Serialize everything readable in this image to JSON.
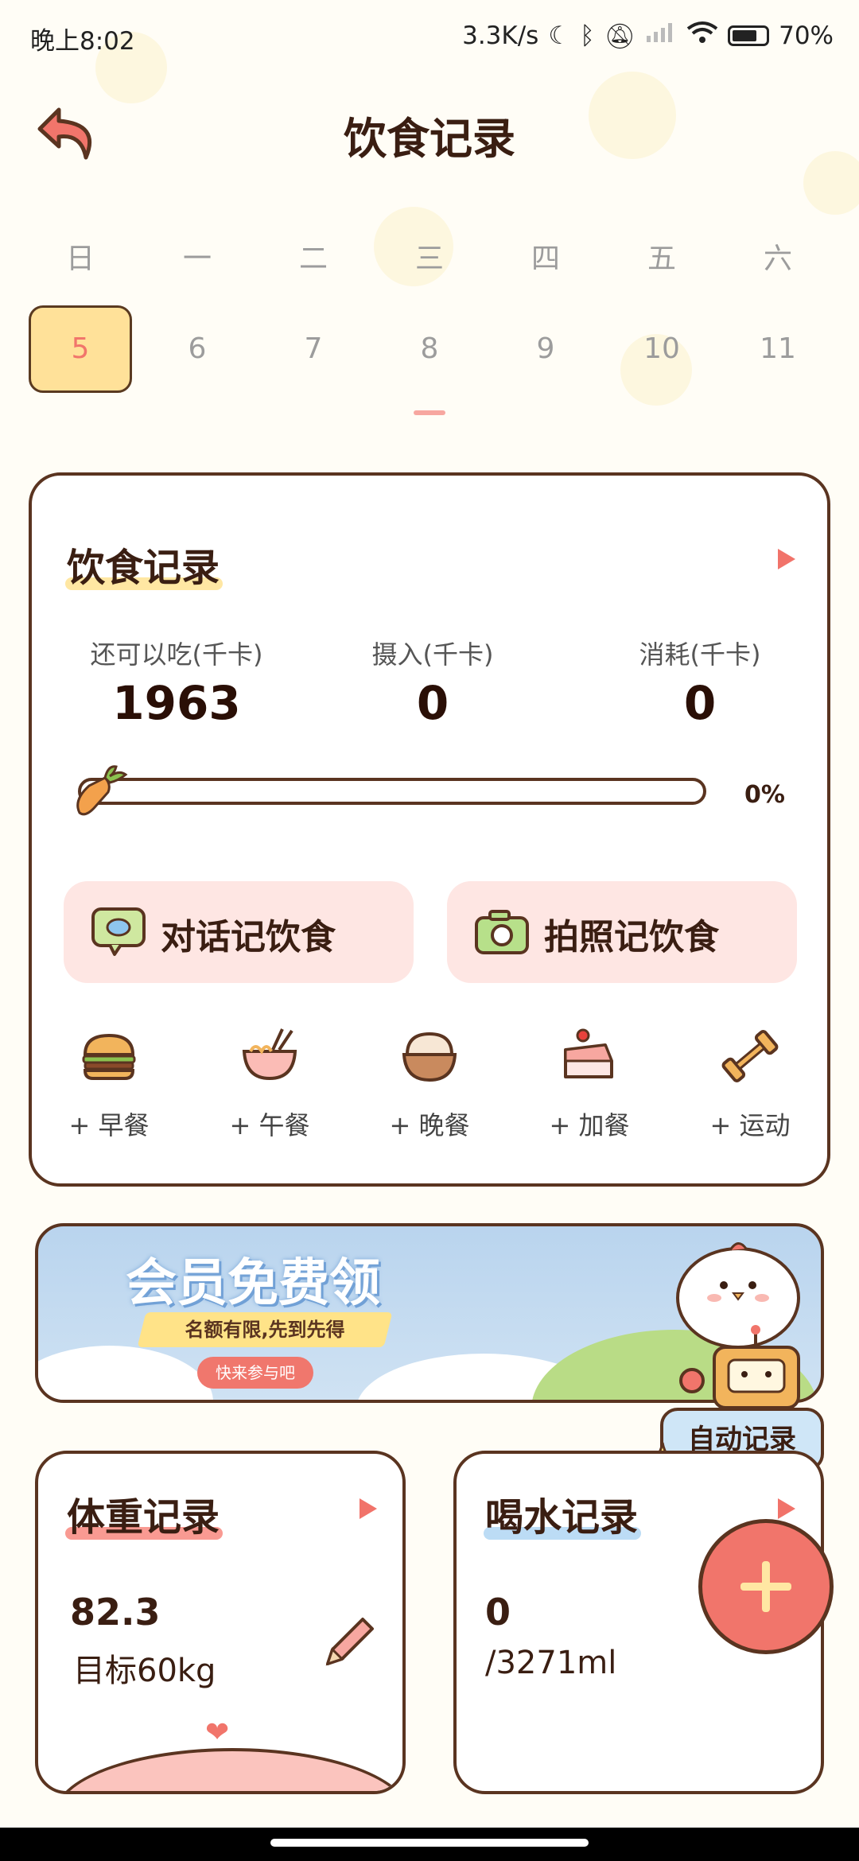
{
  "status_bar": {
    "time": "晚上8:02",
    "speed": "3.3K/s",
    "battery": "70%"
  },
  "header": {
    "title": "饮食记录"
  },
  "week": {
    "days": [
      "日",
      "一",
      "二",
      "三",
      "四",
      "五",
      "六"
    ],
    "dates": [
      "5",
      "6",
      "7",
      "8",
      "9",
      "10",
      "11"
    ],
    "selected_index": 0
  },
  "diet": {
    "title": "饮食记录",
    "remaining_label": "还可以吃(千卡)",
    "remaining_value": "1963",
    "intake_label": "摄入(千卡)",
    "intake_value": "0",
    "burned_label": "消耗(千卡)",
    "burned_value": "0",
    "progress_text": "0%",
    "progress_fraction": 0,
    "chat_button": "对话记饮食",
    "photo_button": "拍照记饮食",
    "meals": [
      "+ 早餐",
      "+ 午餐",
      "+ 晚餐",
      "+ 加餐",
      "+ 运动"
    ]
  },
  "banner": {
    "title": "会员免费领",
    "subtitle": "名额有限,先到先得",
    "button": "快来参与吧"
  },
  "auto_record": "自动记录",
  "weight": {
    "title": "体重记录",
    "value": "82.3",
    "target": "目标60kg"
  },
  "water": {
    "title": "喝水记录",
    "value": "0",
    "target": "/3271ml"
  },
  "colors": {
    "accent": "#f1756b",
    "border": "#5a3420",
    "highlight": "#ffe199"
  }
}
